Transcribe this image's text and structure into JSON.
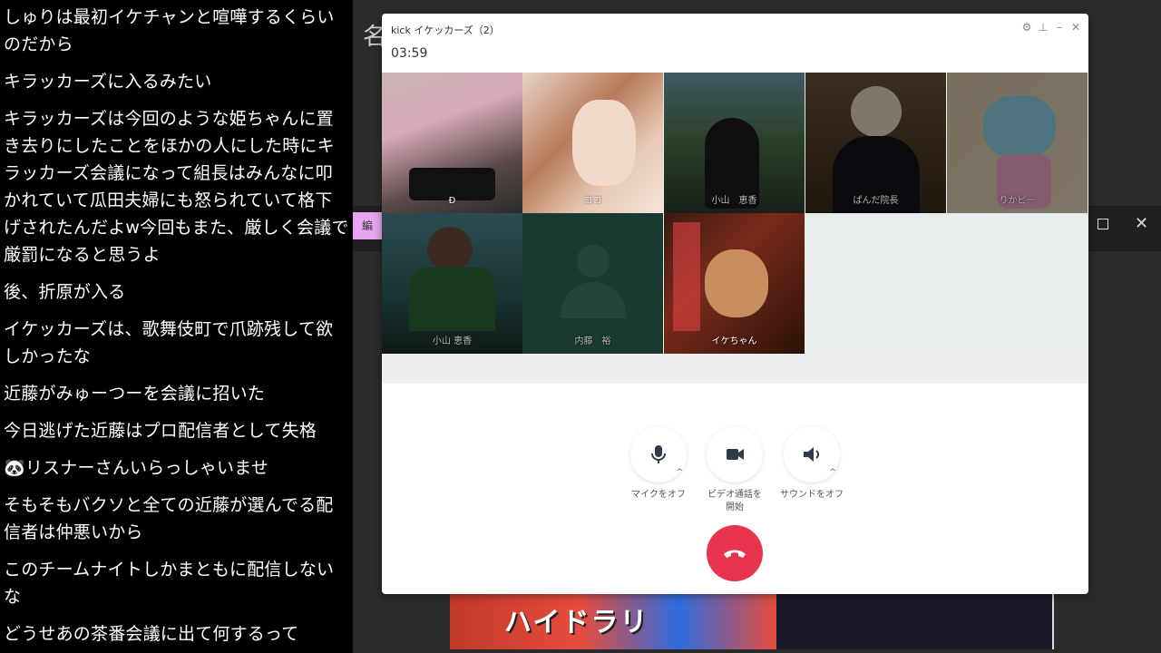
{
  "chat": {
    "messages": [
      "しゅりは最初イケチャンと喧嘩するくらいのだから",
      "キラッカーズに入るみたい",
      "キラッカーズは今回のような姫ちゃんに置き去りにしたことをほかの人にした時にキラッカーズ会議になって組長はみんなに叩かれていて瓜田夫婦にも怒られていて格下げされたんだよw今回もまた、厳しく会議で厳罰になると思うよ",
      "後、折原が入る",
      "イケッカーズは、歌舞伎町で爪跡残して欲しかったな",
      "近藤がみゅーつーを会議に招いた",
      "今日逃げた近藤はプロ配信者として失格",
      "🐼リスナーさんいらっしゃいませ",
      "そもそもバクソと全ての近藤が選んでる配信者は仲悪いから",
      "このチームナイトしかまともに配信しないな",
      "どうせあの茶番会議に出て何するって"
    ]
  },
  "background": {
    "title_fragment": "名",
    "chip_label": "編",
    "video_text": "ハイドラリ"
  },
  "call": {
    "title": "kick イケッカーズ（2）",
    "timer": "03:59",
    "participants": [
      {
        "name": "Đ",
        "active": true
      },
      {
        "name": "ココ",
        "active": true
      },
      {
        "name": "小山　恵香",
        "active": false
      },
      {
        "name": "ぱんだ院長",
        "active": false
      },
      {
        "name": "りかピー",
        "active": false
      },
      {
        "name": "小山 恵香",
        "active": false
      },
      {
        "name": "内藤　裕",
        "active": false
      },
      {
        "name": "イケちゃん",
        "active": true
      }
    ],
    "controls": {
      "mic_label": "マイクをオフ",
      "video_label_line1": "ビデオ通話を",
      "video_label_line2": "開始",
      "sound_label": "サウンドをオフ"
    },
    "colors": {
      "hangup": "#e8344f"
    }
  }
}
